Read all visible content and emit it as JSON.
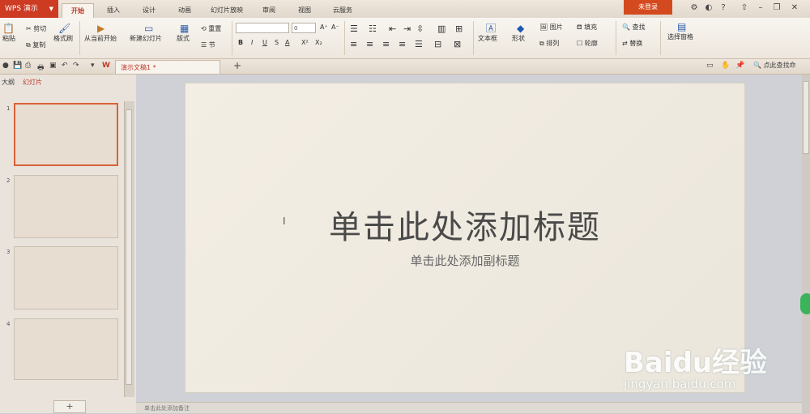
{
  "app": {
    "name": "WPS 演示"
  },
  "menu_tabs": [
    "开始",
    "插入",
    "设计",
    "动画",
    "幻灯片放映",
    "审阅",
    "视图",
    "云服务"
  ],
  "active_tab": "开始",
  "login_label": "未登录",
  "ribbon": {
    "paste": "粘贴",
    "cut": "剪切",
    "copy": "复制",
    "format_painter": "格式刷",
    "from_current": "从当前开始",
    "new_slide": "新建幻灯片",
    "layout": "版式",
    "reset": "重置",
    "section": "节",
    "font_size": "0",
    "bold": "B",
    "italic": "I",
    "underline": "U",
    "strike": "S",
    "font_color": "A",
    "superscript": "X²",
    "subscript": "X₂",
    "grow": "A⁺",
    "shrink": "A⁻",
    "textbox": "文本框",
    "shape": "形状",
    "picture": "图片",
    "fill": "填充",
    "arrange": "排列",
    "outline": "轮廓",
    "find": "查找",
    "replace": "替换",
    "selection_pane": "选择窗格"
  },
  "quickbar": {
    "doc_tab": "演示文稿1 *",
    "add_tab": "+",
    "search": "点此查找命"
  },
  "left_pane": {
    "tab_outline": "大纲",
    "tab_slides": "幻灯片",
    "slide_numbers": [
      "1",
      "2",
      "3",
      "4"
    ],
    "add_button": "+"
  },
  "slide": {
    "title": "单击此处添加标题",
    "subtitle": "单击此处添加副标题"
  },
  "notes": "单击此处添加备注",
  "watermark": {
    "brand": "Baidu经验",
    "url": "jingyan.baidu.com"
  },
  "colors": {
    "accent": "#cc3b22",
    "selected_border": "#d9623a",
    "ribbon_bg": "#f8f5f0"
  }
}
